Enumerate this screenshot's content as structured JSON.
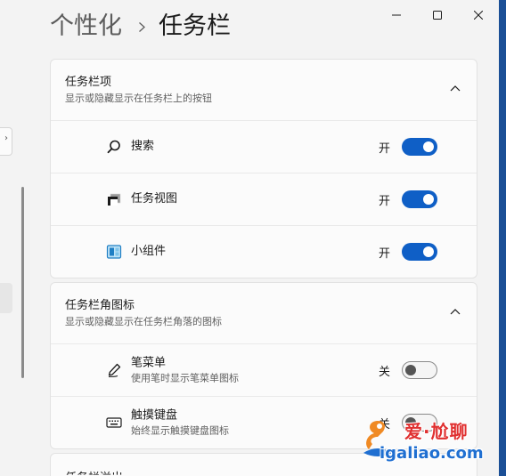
{
  "breadcrumb": {
    "parent": "个性化",
    "current": "任务栏"
  },
  "colors": {
    "accent": "#0f5fc6",
    "watermark_red": "#e03030",
    "watermark_blue": "#1f6fd1"
  },
  "sections": [
    {
      "title": "任务栏项",
      "subtitle": "显示或隐藏显示在任务栏上的按钮",
      "items": [
        {
          "label": "搜索",
          "icon": "search-icon",
          "state": "开",
          "on": true
        },
        {
          "label": "任务视图",
          "icon": "task-view-icon",
          "state": "开",
          "on": true
        },
        {
          "label": "小组件",
          "icon": "widgets-icon",
          "state": "开",
          "on": true
        }
      ]
    },
    {
      "title": "任务栏角图标",
      "subtitle": "显示或隐藏显示在任务栏角落的图标",
      "items": [
        {
          "label": "笔菜单",
          "desc": "使用笔时显示笔菜单图标",
          "icon": "pen-icon",
          "state": "关",
          "on": false
        },
        {
          "label": "触摸键盘",
          "desc": "始终显示触摸键盘图标",
          "icon": "keyboard-icon",
          "state": "关",
          "on": false
        }
      ]
    }
  ],
  "next_section": {
    "title": "任务栏溢出"
  },
  "watermark": {
    "line1": "爱·尬聊",
    "line2": "igaliao.com"
  }
}
